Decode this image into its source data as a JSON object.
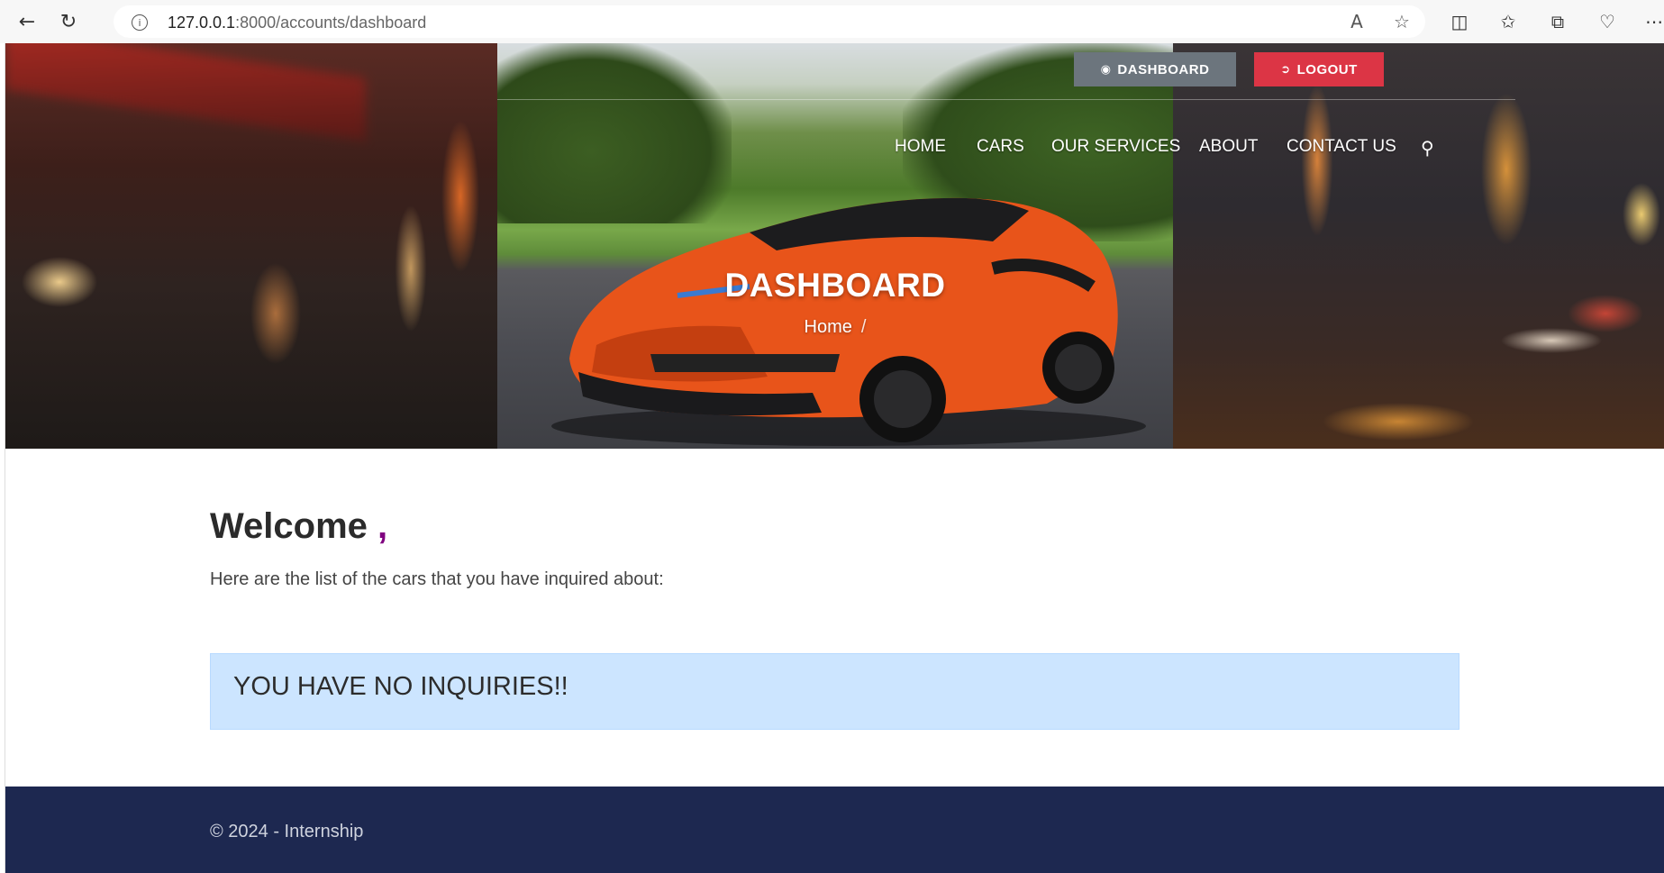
{
  "browser": {
    "url_host": "127.0.0.1",
    "url_rest": ":8000/accounts/dashboard"
  },
  "header": {
    "dashboard_button": "DASHBOARD",
    "logout_button": "LOGOUT",
    "nav": [
      "HOME",
      "CARS",
      "OUR SERVICES",
      "ABOUT",
      "CONTACT US"
    ]
  },
  "hero": {
    "title": "DASHBOARD",
    "breadcrumb_home": "Home",
    "breadcrumb_sep": "/"
  },
  "main": {
    "welcome": "Welcome",
    "welcome_comma": ",",
    "subtext": "Here are the list of the cars that you have inquired about:",
    "no_inquiries": "YOU HAVE NO INQUIRIES!!"
  },
  "footer": {
    "copyright": "© 2024 - Internship"
  },
  "colors": {
    "logout": "#dc3545",
    "dashboard": "#6c757d",
    "alert_bg": "#cce5ff",
    "footer_bg": "#1d2850",
    "comma": "#800080"
  },
  "icons": [
    "back-arrow-icon",
    "refresh-icon",
    "info-icon",
    "read-aloud-icon",
    "favorite-star-icon",
    "split-screen-icon",
    "favorites-icon",
    "collections-icon",
    "browser-essentials-icon",
    "more-icon",
    "tachometer-icon",
    "sign-out-icon",
    "search-icon"
  ]
}
